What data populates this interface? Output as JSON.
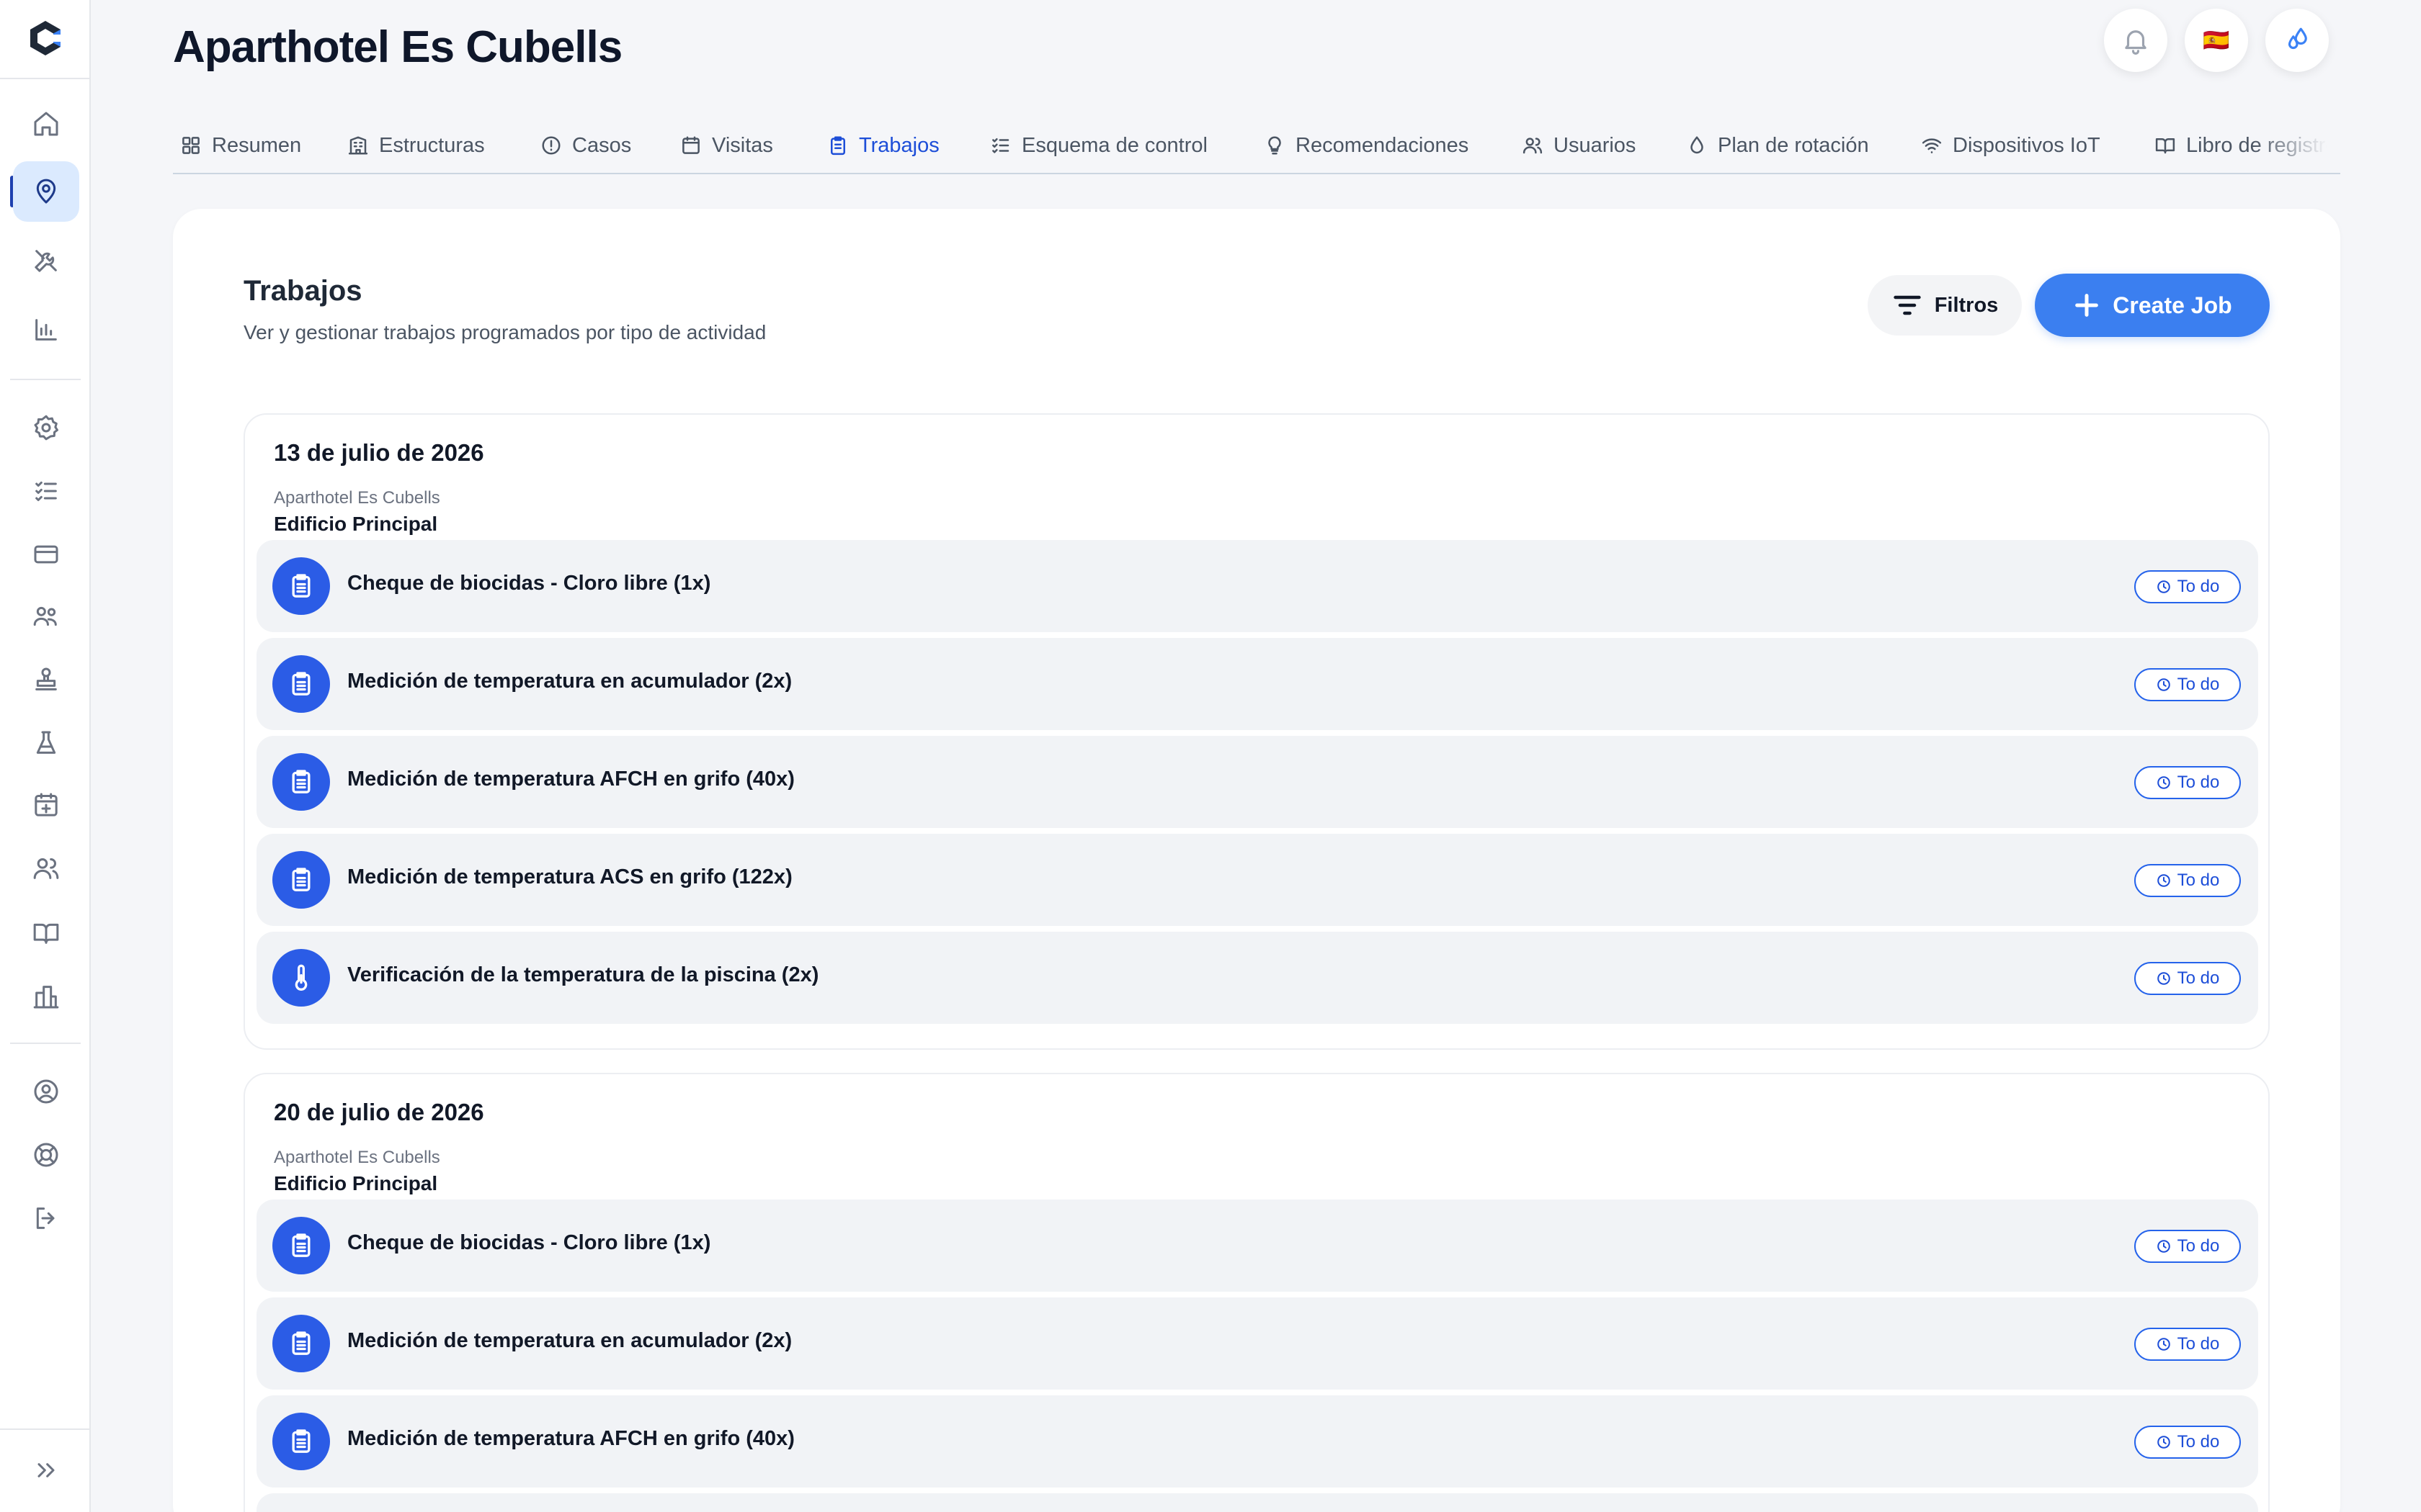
{
  "app": {
    "title": "Aparthotel Es Cubells",
    "language_flag": "🇪🇸"
  },
  "tabs": [
    {
      "label": "Resumen",
      "icon": "grid-icon",
      "active": false
    },
    {
      "label": "Estructuras",
      "icon": "building-icon",
      "active": false
    },
    {
      "label": "Casos",
      "icon": "alert-circle-icon",
      "active": false
    },
    {
      "label": "Visitas",
      "icon": "calendar-icon",
      "active": false
    },
    {
      "label": "Trabajos",
      "icon": "clipboard-icon",
      "active": true
    },
    {
      "label": "Esquema de control",
      "icon": "checklist-icon",
      "active": false
    },
    {
      "label": "Recomendaciones",
      "icon": "lightbulb-icon",
      "active": false
    },
    {
      "label": "Usuarios",
      "icon": "users-icon",
      "active": false
    },
    {
      "label": "Plan de rotación",
      "icon": "drop-icon",
      "active": false
    },
    {
      "label": "Dispositivos IoT",
      "icon": "wifi-icon",
      "active": false
    },
    {
      "label": "Libro de registro",
      "icon": "book-icon",
      "active": false
    }
  ],
  "jobs_section": {
    "title": "Trabajos",
    "subtitle": "Ver y gestionar trabajos programados por tipo de actividad",
    "filter_label": "Filtros",
    "create_label": "Create Job"
  },
  "groups": [
    {
      "date": "13 de julio de 2026",
      "organization": "Aparthotel Es Cubells",
      "building": "Edificio Principal",
      "jobs": [
        {
          "title": "Cheque de biocidas - Cloro libre (1x)",
          "status": "To do",
          "icon": "clipboard-icon"
        },
        {
          "title": "Medición de temperatura en acumulador (2x)",
          "status": "To do",
          "icon": "clipboard-icon"
        },
        {
          "title": "Medición de temperatura AFCH en grifo (40x)",
          "status": "To do",
          "icon": "clipboard-icon"
        },
        {
          "title": "Medición de temperatura ACS en grifo (122x)",
          "status": "To do",
          "icon": "clipboard-icon"
        },
        {
          "title": "Verificación de la temperatura de la piscina (2x)",
          "status": "To do",
          "icon": "thermometer-icon"
        }
      ]
    },
    {
      "date": "20 de julio de 2026",
      "organization": "Aparthotel Es Cubells",
      "building": "Edificio Principal",
      "jobs": [
        {
          "title": "Cheque de biocidas - Cloro libre (1x)",
          "status": "To do",
          "icon": "clipboard-icon"
        },
        {
          "title": "Medición de temperatura en acumulador (2x)",
          "status": "To do",
          "icon": "clipboard-icon"
        },
        {
          "title": "Medición de temperatura AFCH en grifo (40x)",
          "status": "To do",
          "icon": "clipboard-icon"
        }
      ]
    }
  ],
  "colors": {
    "accent": "#2b5ce6",
    "primary_button": "#3b7ff0",
    "active_tab": "#1d4ed8",
    "background": "#f5f6f9"
  }
}
